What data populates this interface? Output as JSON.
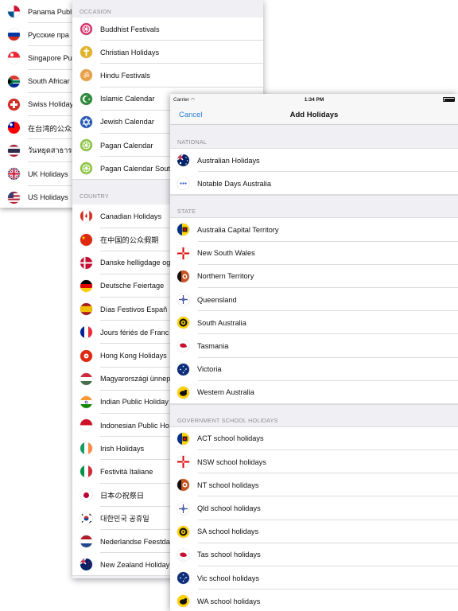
{
  "left_list": {
    "items": [
      {
        "label": "Panama Publ",
        "flag": "panama-flag"
      },
      {
        "label": "Русские пра",
        "flag": "russia-flag"
      },
      {
        "label": "Singapore Pu",
        "flag": "singapore-flag"
      },
      {
        "label": "South Africar",
        "flag": "south-africa-flag"
      },
      {
        "label": "Swiss Holiday",
        "flag": "switzerland-flag"
      },
      {
        "label": "在台湾的公众",
        "flag": "taiwan-flag"
      },
      {
        "label": "วันหยุดสาธารณ",
        "flag": "thailand-flag"
      },
      {
        "label": "UK Holidays",
        "flag": "uk-flag"
      },
      {
        "label": "US Holidays",
        "flag": "us-flag"
      }
    ]
  },
  "middle_list": {
    "occasion_header": "OCCASION",
    "occasion_items": [
      {
        "label": "Buddhist Festivals",
        "icon": "dharma-wheel-icon"
      },
      {
        "label": "Christian Holidays",
        "icon": "cross-icon"
      },
      {
        "label": "Hindu Festivals",
        "icon": "om-icon"
      },
      {
        "label": "Islamic Calendar",
        "icon": "crescent-icon"
      },
      {
        "label": "Jewish Calendar",
        "icon": "star-of-david-icon"
      },
      {
        "label": "Pagan Calendar",
        "icon": "pagan-wheel-icon"
      },
      {
        "label": "Pagan Calendar Sout",
        "icon": "pagan-wheel-icon"
      }
    ],
    "country_header": "COUNTRY",
    "country_items": [
      {
        "label": "Canadian Holidays",
        "flag": "canada-flag"
      },
      {
        "label": "在中国的公众假期",
        "flag": "china-flag"
      },
      {
        "label": "Danske helligdage og",
        "flag": "denmark-flag"
      },
      {
        "label": "Deutsche Feiertage",
        "flag": "germany-flag"
      },
      {
        "label": "Días Festivos Españ",
        "flag": "spain-flag"
      },
      {
        "label": "Jours fériés de Franc",
        "flag": "france-flag"
      },
      {
        "label": "Hong Kong Holidays",
        "flag": "hong-kong-flag"
      },
      {
        "label": "Magyarországi ünnep",
        "flag": "hungary-flag"
      },
      {
        "label": "Indian Public Holiday",
        "flag": "india-flag"
      },
      {
        "label": "Indonesian Public Ho",
        "flag": "indonesia-flag"
      },
      {
        "label": "Irish Holidays",
        "flag": "ireland-flag"
      },
      {
        "label": "Festività Italiane",
        "flag": "italy-flag"
      },
      {
        "label": "日本の祝祭日",
        "flag": "japan-flag"
      },
      {
        "label": "대한민국 공휴일",
        "flag": "south-korea-flag"
      },
      {
        "label": "Nederlandse Feestda",
        "flag": "netherlands-flag"
      },
      {
        "label": "New Zealand Holiday",
        "flag": "new-zealand-flag"
      }
    ]
  },
  "add_holidays": {
    "status": {
      "carrier": "Carrier",
      "time": "1:34 PM"
    },
    "nav": {
      "cancel": "Cancel",
      "title": "Add Holidays"
    },
    "sections": [
      {
        "header": "NATIONAL",
        "items": [
          {
            "label": "Australian Holidays",
            "flag": "australia-flag"
          },
          {
            "label": "Notable Days Australia",
            "flag": "more-dots-icon"
          }
        ]
      },
      {
        "header": "STATE",
        "items": [
          {
            "label": "Australia Capital Territory",
            "flag": "act-flag"
          },
          {
            "label": "New South Wales",
            "flag": "nsw-flag"
          },
          {
            "label": "Northern Territory",
            "flag": "nt-flag"
          },
          {
            "label": "Queensland",
            "flag": "qld-flag"
          },
          {
            "label": "South Australia",
            "flag": "sa-flag"
          },
          {
            "label": "Tasmania",
            "flag": "tas-flag"
          },
          {
            "label": "Victoria",
            "flag": "vic-flag"
          },
          {
            "label": "Western Australia",
            "flag": "wa-flag"
          }
        ]
      },
      {
        "header": "GOVERNMENT SCHOOL HOLIDAYS",
        "items": [
          {
            "label": "ACT school holidays",
            "flag": "act-flag"
          },
          {
            "label": "NSW school holidays",
            "flag": "nsw-flag"
          },
          {
            "label": "NT school holidays",
            "flag": "nt-flag"
          },
          {
            "label": "Qld school holidays",
            "flag": "qld-flag"
          },
          {
            "label": "SA school holidays",
            "flag": "sa-flag"
          },
          {
            "label": "Tas school holidays",
            "flag": "tas-flag"
          },
          {
            "label": "Vic school holidays",
            "flag": "vic-flag"
          },
          {
            "label": "WA school holidays",
            "flag": "wa-flag"
          }
        ]
      }
    ]
  }
}
